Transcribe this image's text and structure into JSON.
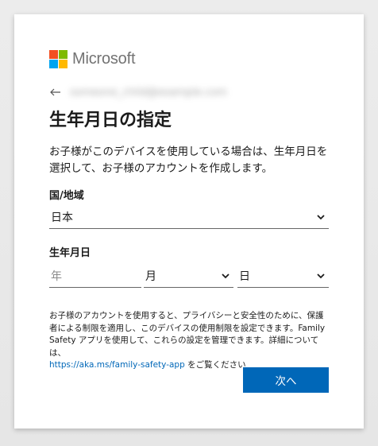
{
  "brand": {
    "name": "Microsoft",
    "colors": [
      "#f25022",
      "#7fba00",
      "#00a4ef",
      "#ffb900"
    ]
  },
  "header": {
    "identity": "someone_child@example.com"
  },
  "title": "生年月日の指定",
  "description": "お子様がこのデバイスを使用している場合は、生年月日を選択して、お子様のアカウントを作成します。",
  "region": {
    "label": "国/地域",
    "selected": "日本"
  },
  "birthdate": {
    "label": "生年月日",
    "year_placeholder": "年",
    "month_selected": "月",
    "day_selected": "日"
  },
  "notice": {
    "text": "お子様のアカウントを使用すると、プライバシーと安全性のために、保護者による制限を適用し、このデバイスの使用制限を設定できます。Family Safety アプリを使用して、これらの設定を管理できます。詳細については、",
    "link": "https://aka.ms/family-safety-app",
    "suffix": " をご覧ください"
  },
  "buttons": {
    "next": "次へ"
  },
  "colors": {
    "accent": "#0067b8"
  }
}
